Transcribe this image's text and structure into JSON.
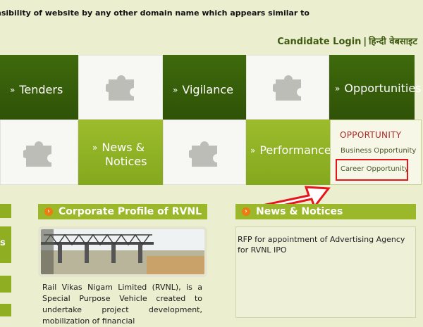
{
  "ticker": {
    "text": "nsibility of website by any other domain name which appears similar to"
  },
  "topnav": {
    "candidate_login": "Candidate Login",
    "separator": "|",
    "hindi_website": "हिन्दी वेबसाइट"
  },
  "tiles": {
    "tenders": "Tenders",
    "vigilance": "Vigilance",
    "opportunities": "Opportunities",
    "news_notices_line1": "News &",
    "news_notices_line2": "Notices",
    "performance": "Performance"
  },
  "dropdown": {
    "heading": "OPPORTUNITY",
    "items": [
      "Business Opportunity",
      "Career Opportunity"
    ]
  },
  "left_stub_letter": "s",
  "corporate_profile": {
    "title": "Corporate Profile of RVNL",
    "body": "Rail Vikas Nigam Limited (RVNL), is a Special Purpose Vehicle created to undertake project development, mobilization of financial"
  },
  "news_notices": {
    "title": "News & Notices",
    "items": [
      "RFP for appointment of Advertising Agency for RVNL IPO"
    ]
  },
  "colors": {
    "dark_green": "#2f5207",
    "light_green": "#9ab82a",
    "accent_red": "#e8141c",
    "bullet_orange": "#ee7a12"
  }
}
